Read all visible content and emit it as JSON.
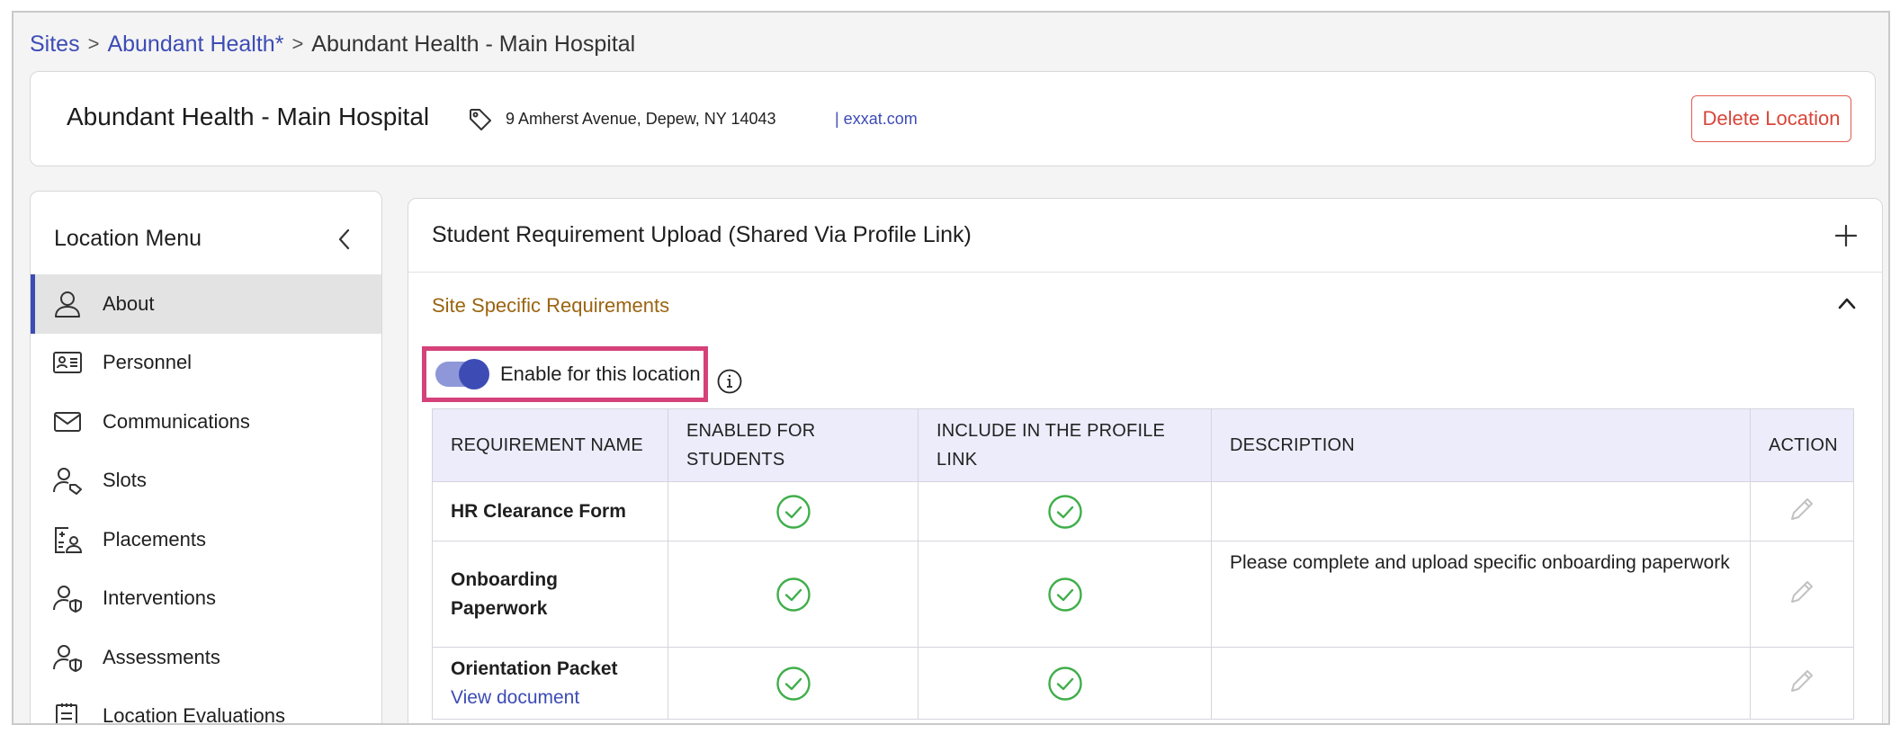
{
  "breadcrumb": {
    "items": [
      "Sites",
      "Abundant Health*",
      "Abundant Health - Main Hospital"
    ],
    "separator": ">"
  },
  "header": {
    "title": "Abundant Health - Main Hospital",
    "address": "9 Amherst Avenue, Depew, NY 14043",
    "website": "| exxat.com",
    "delete_label": "Delete Location"
  },
  "sidebar": {
    "title": "Location Menu",
    "items": [
      {
        "label": "About",
        "icon": "person-icon",
        "active": true
      },
      {
        "label": "Personnel",
        "icon": "id-card-icon"
      },
      {
        "label": "Communications",
        "icon": "mail-icon"
      },
      {
        "label": "Slots",
        "icon": "person-tag-icon"
      },
      {
        "label": "Placements",
        "icon": "clipboard-person-icon"
      },
      {
        "label": "Interventions",
        "icon": "person-shield-icon"
      },
      {
        "label": "Assessments",
        "icon": "person-shield-icon"
      },
      {
        "label": "Location Evaluations",
        "icon": "checklist-icon"
      }
    ]
  },
  "main": {
    "section_title": "Student Requirement Upload (Shared Via Profile Link)",
    "subsection_title": "Site Specific Requirements",
    "toggle": {
      "label": "Enable for this location",
      "enabled": true
    },
    "table": {
      "headers": [
        "REQUIREMENT NAME",
        "ENABLED FOR STUDENTS",
        "INCLUDE IN THE PROFILE LINK",
        "DESCRIPTION",
        "ACTION"
      ],
      "rows": [
        {
          "name": "HR Clearance Form",
          "link": "",
          "enabled": true,
          "include": true,
          "description": ""
        },
        {
          "name": "Onboarding Paperwork",
          "link": "",
          "enabled": true,
          "include": true,
          "description": "Please complete and upload specific onboarding paperwork"
        },
        {
          "name": "Orientation Packet",
          "link": "View document",
          "enabled": true,
          "include": true,
          "description": ""
        }
      ]
    }
  },
  "colors": {
    "accent": "#3d4cb5",
    "danger": "#d8463a",
    "subsection": "#9b6411",
    "check": "#3fae4a",
    "highlight": "#d5427a"
  }
}
